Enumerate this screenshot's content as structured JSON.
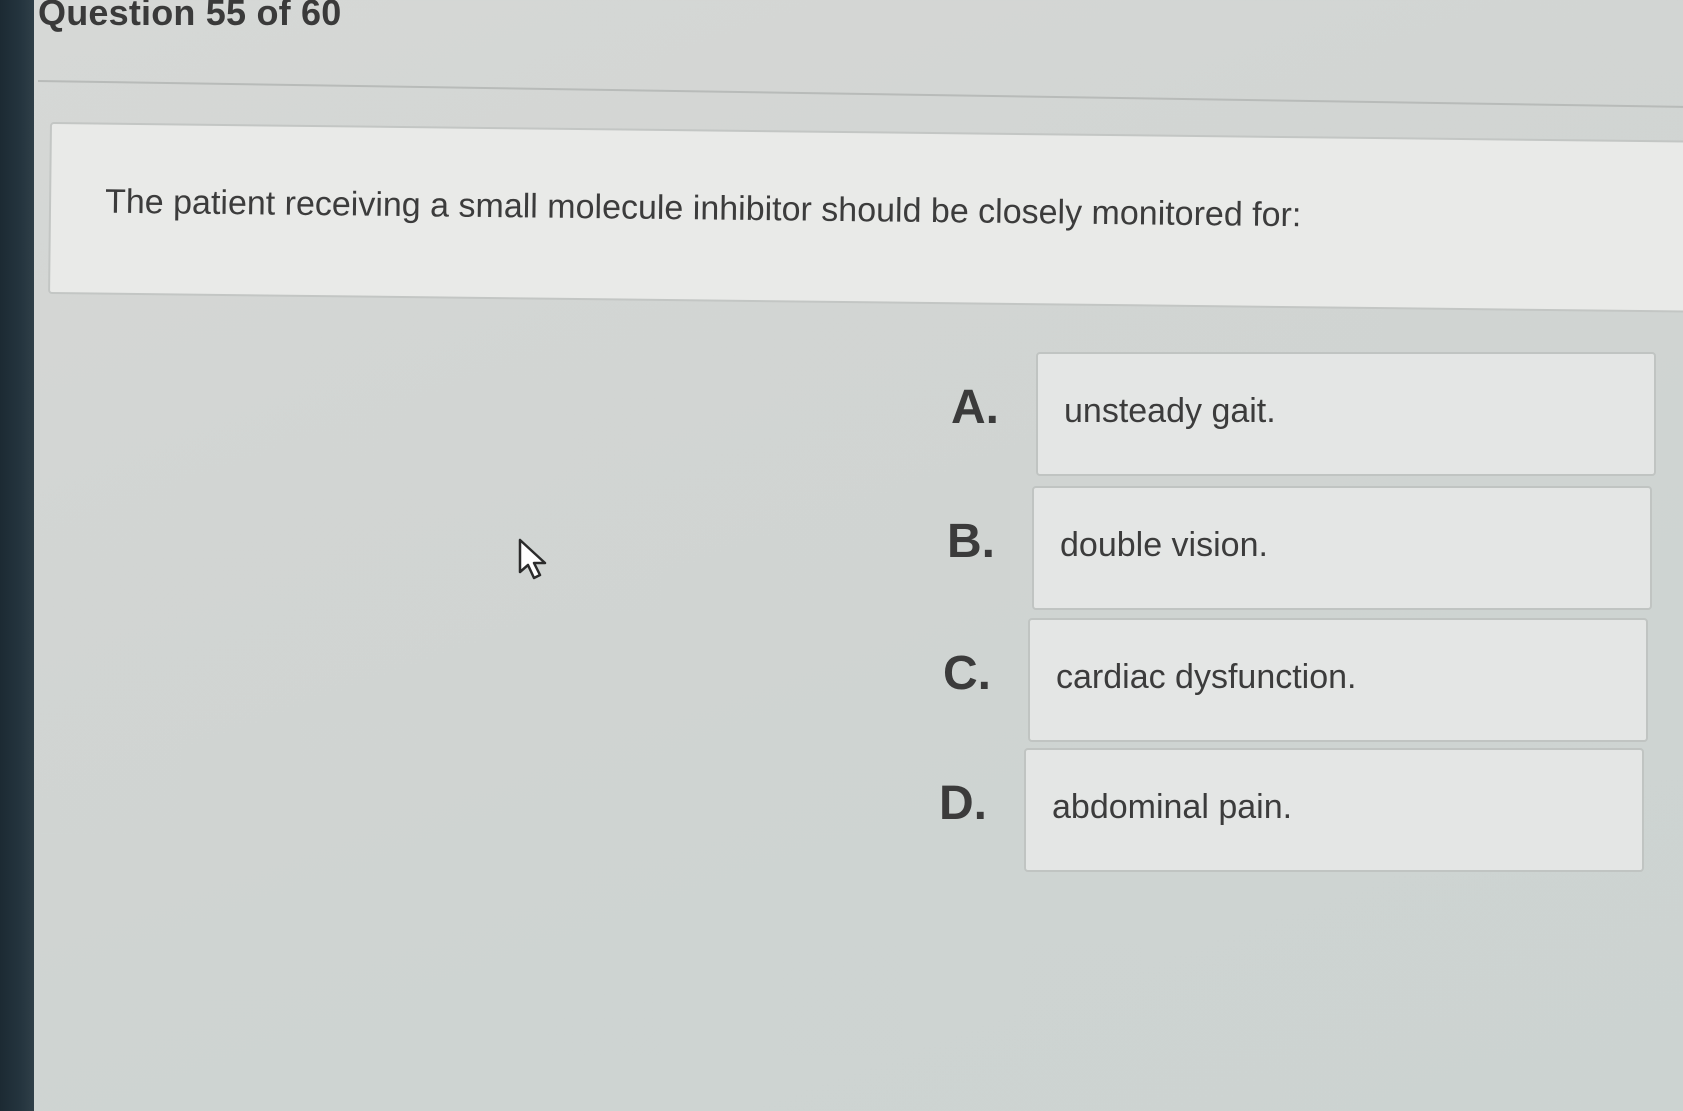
{
  "header": {
    "title": "Question 55 of 60"
  },
  "question": {
    "text": "The patient receiving a small molecule inhibitor should be closely monitored for:"
  },
  "options": [
    {
      "letter": "A.",
      "text": "unsteady gait."
    },
    {
      "letter": "B.",
      "text": "double vision."
    },
    {
      "letter": "C.",
      "text": "cardiac dysfunction."
    },
    {
      "letter": "D.",
      "text": "abdominal pain."
    }
  ],
  "cursor": {
    "icon": "mouse-pointer-icon"
  }
}
